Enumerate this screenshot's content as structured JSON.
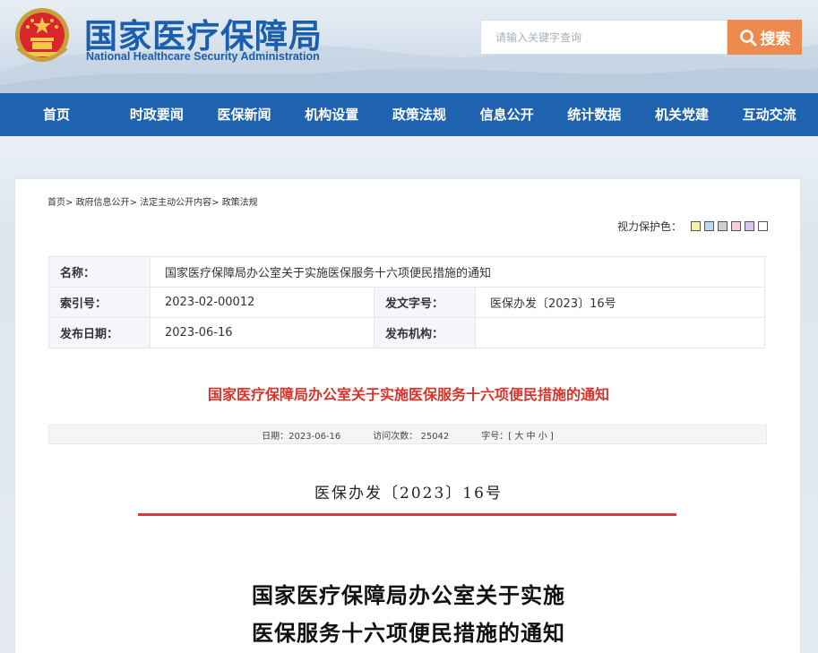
{
  "header": {
    "title_cn": "国家医疗保障局",
    "title_en": "National Healthcare Security Administration",
    "search_placeholder": "请输入关键字查询",
    "search_button": "搜索",
    "search_icon": "magnifier-icon",
    "logo_icon": "national-emblem-icon"
  },
  "nav": {
    "items": [
      "首页",
      "时政要闻",
      "医保新闻",
      "机构设置",
      "政策法规",
      "信息公开",
      "统计数据",
      "机关党建",
      "互动交流"
    ]
  },
  "breadcrumb": {
    "items": [
      "首页",
      "政府信息公开",
      "法定主动公开内容",
      "政策法规"
    ],
    "separator": "> "
  },
  "vision": {
    "label": "视力保护色：",
    "swatches": [
      "#f5f0a8",
      "#b8dcf4",
      "#cfcfcf",
      "#f7cfd9",
      "#dac6ee",
      "#ffffff"
    ]
  },
  "info": {
    "name_label": "名称：",
    "name_value": "国家医疗保障局办公室关于实施医保服务十六项便民措施的通知",
    "index_label": "索引号：",
    "index_value": "2023-02-00012",
    "docno_label": "发文字号：",
    "docno_value": "医保办发〔2023〕16号",
    "date_label": "发布日期：",
    "date_value": "2023-06-16",
    "org_label": "发布机构：",
    "org_value": ""
  },
  "article": {
    "title": "国家医疗保障局办公室关于实施医保服务十六项便民措施的通知",
    "meta_date": "日期：2023-06-16",
    "meta_visits": "访问次数： 25042",
    "meta_fontsize": "字号：[ 大 中 小 ]",
    "doc_number": "医保办发〔2023〕16号",
    "heading_line1": "国家医疗保障局办公室关于实施",
    "heading_line2": "医保服务十六项便民措施的通知"
  },
  "colors": {
    "brand_blue": "#1e62b0",
    "search_orange": "#ec8a4f",
    "title_red": "#d8342b",
    "rule_red": "#e0373b"
  }
}
